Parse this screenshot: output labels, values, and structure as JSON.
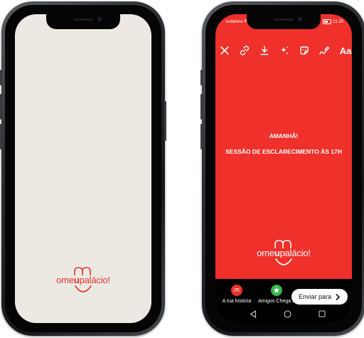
{
  "colors": {
    "brand_red": "#e8312c",
    "story_red": "#f0302b",
    "left_bg": "#ece9e3",
    "frame": "#1a1b1e"
  },
  "brand": {
    "prefix": "ome",
    "bold": "u",
    "suffix": "palácio!"
  },
  "status_bar": {
    "carrier": "vodafone P",
    "time": "21:20"
  },
  "story_toolbar": {
    "icons": [
      "close-icon",
      "link-icon",
      "download-icon",
      "effects-icon",
      "sticker-icon",
      "draw-icon"
    ],
    "text_label": "Aa"
  },
  "story": {
    "line1": "AMANHÃ!",
    "line2": "SESSÃO DE ESCLARECIMENTO ÀS 17H"
  },
  "share_bar": {
    "your_story_label": "A tua história",
    "close_friends_label": "Amigos Chega...",
    "send_label": "Enviar para"
  },
  "nav_icons": [
    "back-triangle-icon",
    "home-circle-icon",
    "recents-square-icon"
  ]
}
